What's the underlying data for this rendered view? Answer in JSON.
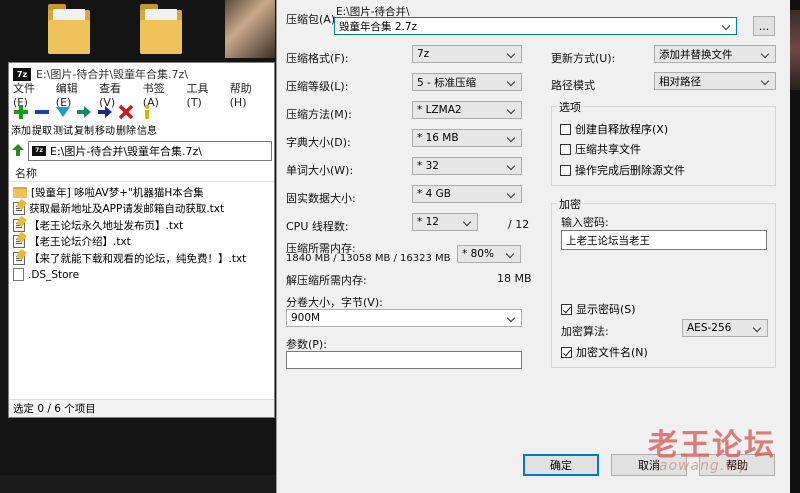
{
  "file_manager": {
    "title": "E:\\图片-待合并\\毁童年合集.7z\\",
    "logo": "7z",
    "menu": [
      "文件(F)",
      "编辑(E)",
      "查看(V)",
      "书签(A)",
      "工具(T)",
      "帮助(H)"
    ],
    "toolbar": [
      {
        "label": "添加",
        "icon": "add-icon",
        "color": "#10a010"
      },
      {
        "label": "提取",
        "icon": "extract-icon",
        "color": "#1a3fb5"
      },
      {
        "label": "测试",
        "icon": "test-icon",
        "color": "#1aa0c8"
      },
      {
        "label": "复制",
        "icon": "copy-icon",
        "color": "#148a6a"
      },
      {
        "label": "移动",
        "icon": "move-icon",
        "color": "#1a2a8a"
      },
      {
        "label": "删除",
        "icon": "delete-icon",
        "color": "#d01818"
      },
      {
        "label": "信息",
        "icon": "info-icon",
        "color": "#d8b400"
      }
    ],
    "address": "E:\\图片-待合并\\毁童年合集.7z\\",
    "column_header": "名称",
    "items": [
      {
        "name": "[毁童年] 哆啦AV梦+\"机器猫H本合集",
        "type": "folder"
      },
      {
        "name": "获取最新地址及APP请发邮箱自动获取.txt",
        "type": "txt"
      },
      {
        "name": "【老王论坛永久地址发布页】.txt",
        "type": "txt"
      },
      {
        "name": "【老王论坛介绍】.txt",
        "type": "txt"
      },
      {
        "name": "【来了就能下载和观看的论坛，纯免费！】.txt",
        "type": "txt"
      },
      {
        "name": ".DS_Store",
        "type": "file"
      }
    ],
    "status": "选定 0 / 6 个项目"
  },
  "dialog": {
    "archive_label": "压缩包(A):",
    "archive_path": "E:\\图片-待合并\\",
    "archive_name": "毁童年合集 2.7z",
    "browse_label": "...",
    "format_label": "压缩格式(F):",
    "format_value": "7z",
    "level_label": "压缩等级(L):",
    "level_value": "5 - 标准压缩",
    "method_label": "压缩方法(M):",
    "method_value": "* LZMA2",
    "dict_label": "字典大小(D):",
    "dict_value": "* 16 MB",
    "word_label": "单词大小(W):",
    "word_value": "* 32",
    "solid_label": "固实数据大小:",
    "solid_value": "* 4 GB",
    "threads_label": "CPU 线程数:",
    "threads_value": "* 12",
    "threads_total": "/ 12",
    "mem_comp_label": "压缩所需内存:",
    "mem_comp_detail": "1840 MB / 13058 MB / 16323 MB",
    "mem_comp_percent": "* 80%",
    "mem_decomp_label": "解压缩所需内存:",
    "mem_decomp_value": "18 MB",
    "split_label": "分卷大小，字节(V):",
    "split_value": "900M",
    "params_label": "参数(P):",
    "params_value": "",
    "update_label": "更新方式(U):",
    "update_value": "添加并替换文件",
    "path_mode_label": "路径模式",
    "path_mode_value": "相对路径",
    "options_group": "选项",
    "opt_sfx": "创建自释放程序(X)",
    "opt_shared": "压缩共享文件",
    "opt_delete": "操作完成后删除源文件",
    "encrypt_group": "加密",
    "password_label": "输入密码:",
    "password_value": "上老王论坛当老王",
    "show_password": "显示密码(S)",
    "enc_method_label": "加密算法:",
    "enc_method_value": "AES-256",
    "encrypt_names": "加密文件名(N)",
    "ok": "确定",
    "cancel": "取消",
    "help": "帮助"
  },
  "watermark": {
    "main": "老王论坛",
    "sub": "laowang.vip"
  }
}
